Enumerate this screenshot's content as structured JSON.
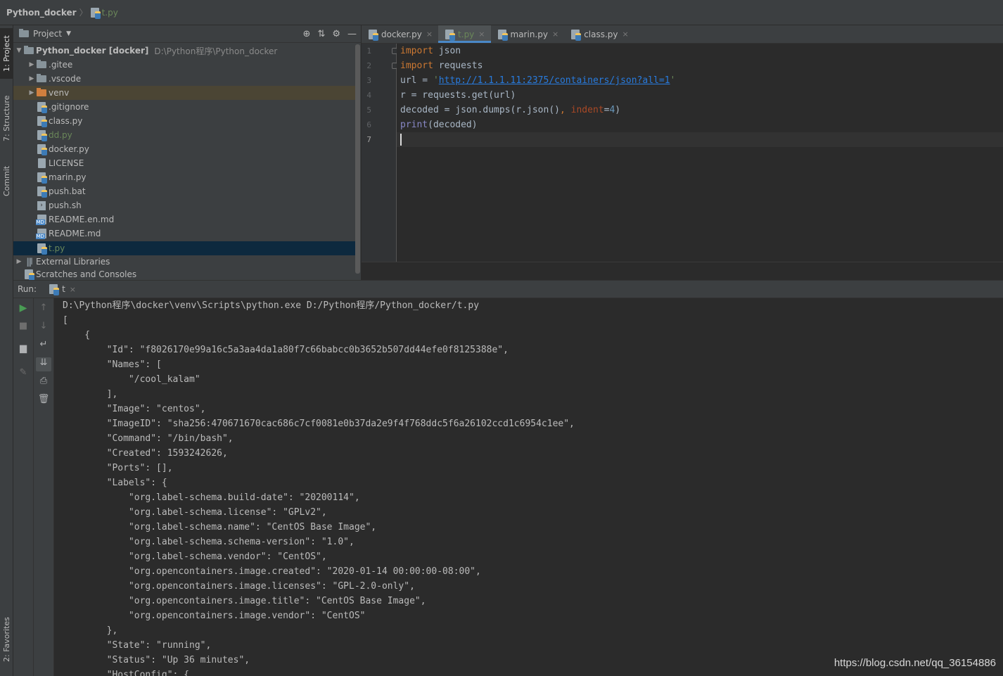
{
  "breadcrumb": {
    "project": "Python_docker",
    "separator": "〉",
    "file": "t.py"
  },
  "left_stripe": {
    "project_tab": "1: Project",
    "structure_tab": "7: Structure",
    "commit_tab": "Commit",
    "favorites_tab": "2: Favorites"
  },
  "project_pane": {
    "title": "Project",
    "tools": [
      "⊕",
      "⇅",
      "⚙",
      "—"
    ],
    "tree": [
      {
        "label": "Python_docker [docker]",
        "path": "D:\\Python程序\\Python_docker"
      },
      {
        "label": ".gitee"
      },
      {
        "label": ".vscode"
      },
      {
        "label": "venv"
      },
      {
        "label": ".gitignore"
      },
      {
        "label": "class.py"
      },
      {
        "label": "dd.py"
      },
      {
        "label": "docker.py"
      },
      {
        "label": "LICENSE"
      },
      {
        "label": "marin.py"
      },
      {
        "label": "push.bat"
      },
      {
        "label": "push.sh"
      },
      {
        "label": "README.en.md"
      },
      {
        "label": "README.md"
      },
      {
        "label": "t.py"
      },
      {
        "label": "External Libraries"
      },
      {
        "label": "Scratches and Consoles"
      }
    ]
  },
  "editor": {
    "tabs": [
      {
        "label": "docker.py",
        "close": "×"
      },
      {
        "label": "t.py",
        "close": "×"
      },
      {
        "label": "marin.py",
        "close": "×"
      },
      {
        "label": "class.py",
        "close": "×"
      }
    ],
    "line_numbers": [
      "1",
      "2",
      "3",
      "4",
      "5",
      "6",
      "7"
    ],
    "code": {
      "l1_kw": "import",
      "l1_rest": " json",
      "l2_kw": "import",
      "l2_rest": " requests",
      "l3_a": "url = ",
      "l3_q1": "'",
      "l3_url": "http://1.1.1.11:2375/containers/json?all=1",
      "l3_q2": "'",
      "l4": "r = requests.get(url)",
      "l5_a": "decoded = json.dumps(r.json()",
      "l5_comma": ", ",
      "l5_param": "indent",
      "l5_eq": "=",
      "l5_num": "4",
      "l5_close": ")",
      "l6_print": "print",
      "l6_rest": "(decoded)"
    }
  },
  "run": {
    "label": "Run:",
    "tab": "t",
    "close": "×",
    "output": [
      "D:\\Python程序\\docker\\venv\\Scripts\\python.exe D:/Python程序/Python_docker/t.py",
      "[",
      "    {",
      "        \"Id\": \"f8026170e99a16c5a3aa4da1a80f7c66babcc0b3652b507dd44efe0f8125388e\",",
      "        \"Names\": [",
      "            \"/cool_kalam\"",
      "        ],",
      "        \"Image\": \"centos\",",
      "        \"ImageID\": \"sha256:470671670cac686c7cf0081e0b37da2e9f4f768ddc5f6a26102ccd1c6954c1ee\",",
      "        \"Command\": \"/bin/bash\",",
      "        \"Created\": 1593242626,",
      "        \"Ports\": [],",
      "        \"Labels\": {",
      "            \"org.label-schema.build-date\": \"20200114\",",
      "            \"org.label-schema.license\": \"GPLv2\",",
      "            \"org.label-schema.name\": \"CentOS Base Image\",",
      "            \"org.label-schema.schema-version\": \"1.0\",",
      "            \"org.label-schema.vendor\": \"CentOS\",",
      "            \"org.opencontainers.image.created\": \"2020-01-14 00:00:00-08:00\",",
      "            \"org.opencontainers.image.licenses\": \"GPL-2.0-only\",",
      "            \"org.opencontainers.image.title\": \"CentOS Base Image\",",
      "            \"org.opencontainers.image.vendor\": \"CentOS\"",
      "        },",
      "        \"State\": \"running\",",
      "        \"Status\": \"Up 36 minutes\",",
      "        \"HostConfig\": {"
    ]
  },
  "watermark": "https://blog.csdn.net/qq_36154886",
  "colors": {
    "background": "#2b2b2b",
    "panel": "#3c3f41",
    "keyword": "#cc7832",
    "string": "#6a8759",
    "selection": "#0d293e",
    "accent": "#4a88c7"
  }
}
